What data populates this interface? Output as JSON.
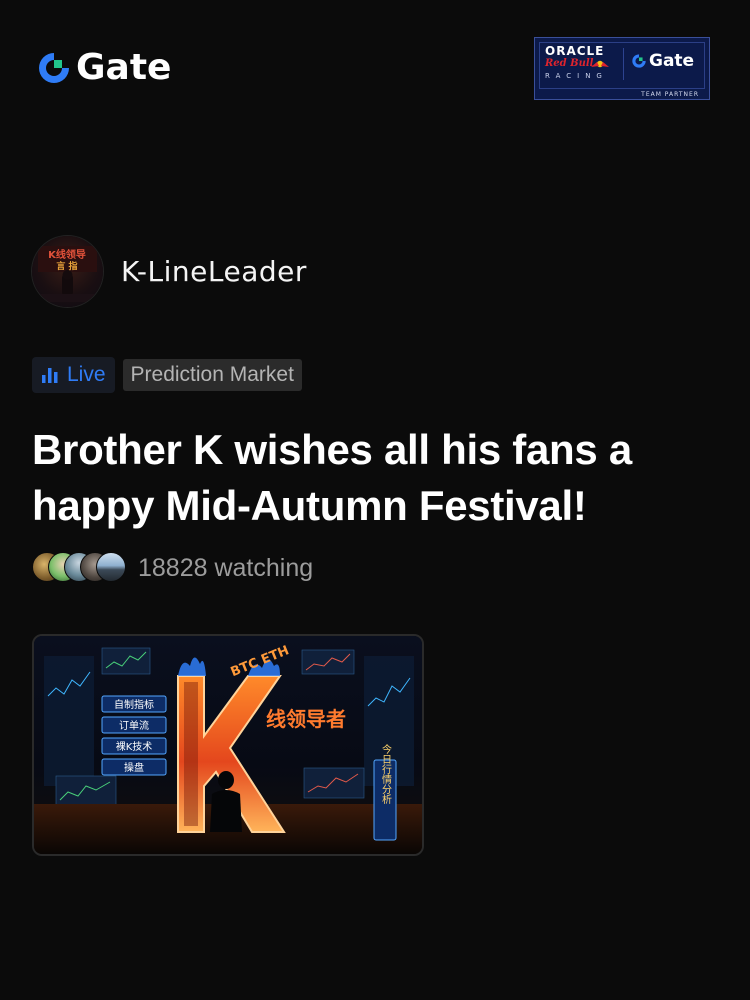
{
  "header": {
    "brand_name": "Gate",
    "brand_icon": "gate-logo-icon",
    "brand_color": "#2f7cf6",
    "partner": {
      "oracle": "ORACLE",
      "red_bull": "Red Bull",
      "racing": "RACING",
      "gate": "Gate",
      "caption": "TEAM PARTNER",
      "background": "#0c1a4a"
    }
  },
  "author": {
    "name": "K-LineLeader",
    "avatar_icon": "author-avatar"
  },
  "tags": {
    "live_label": "Live",
    "live_icon": "bar-chart-icon",
    "live_color": "#2f7cf6",
    "category_label": "Prediction Market"
  },
  "stream": {
    "title": "Brother K wishes all his fans a happy Mid-Autumn Festival!",
    "watching_text": "18828 watching",
    "watcher_count": 18828
  },
  "thumbnail": {
    "big_letter": "K",
    "coins": "BTC ETH",
    "headline": "线领导者",
    "menu": [
      "自制指标",
      "订单流",
      "裸K技术",
      "操盘"
    ],
    "side_text": "今日行情分析"
  }
}
